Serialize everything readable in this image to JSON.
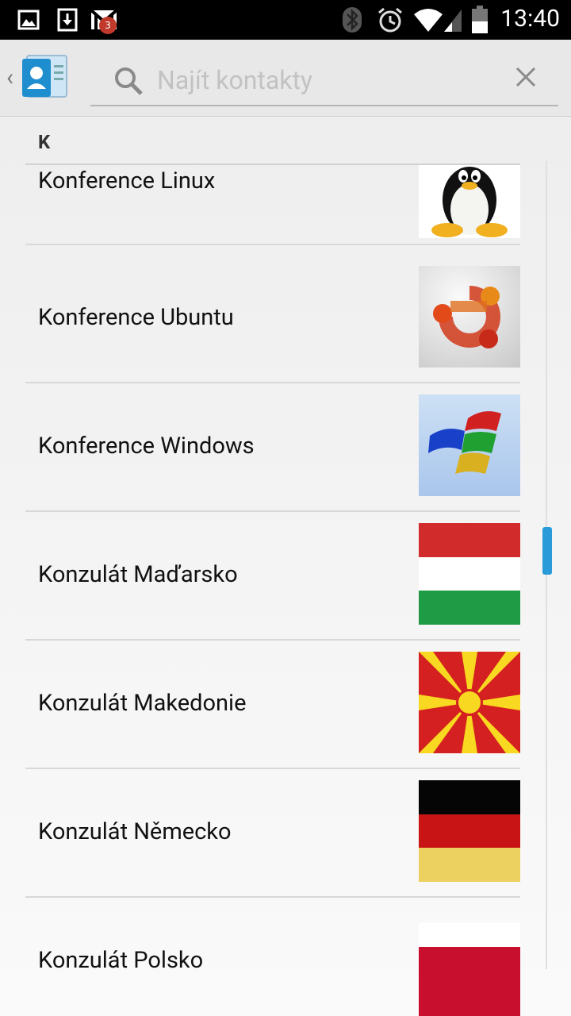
{
  "status_bar": {
    "time": "13:40",
    "notification_count": "3"
  },
  "action_bar": {
    "search_placeholder": "Najít kontakty",
    "search_value": ""
  },
  "list": {
    "section_letter": "K",
    "contacts": [
      {
        "name": "Konference Linux",
        "photo": "tux-penguin"
      },
      {
        "name": "Konference Ubuntu",
        "photo": "ubuntu-logo-3d"
      },
      {
        "name": "Konference Windows",
        "photo": "windows-logo-3d"
      },
      {
        "name": "Konzulát Maďarsko",
        "photo": "flag-hungary"
      },
      {
        "name": "Konzulát Makedonie",
        "photo": "flag-macedonia"
      },
      {
        "name": "Konzulát Německo",
        "photo": "flag-germany"
      },
      {
        "name": "Konzulát Polsko",
        "photo": "flag-poland"
      }
    ]
  },
  "colors": {
    "status_bar": "#000000",
    "action_bar": "#e8e8e8",
    "scroll_thumb": "#2a9bd8"
  }
}
